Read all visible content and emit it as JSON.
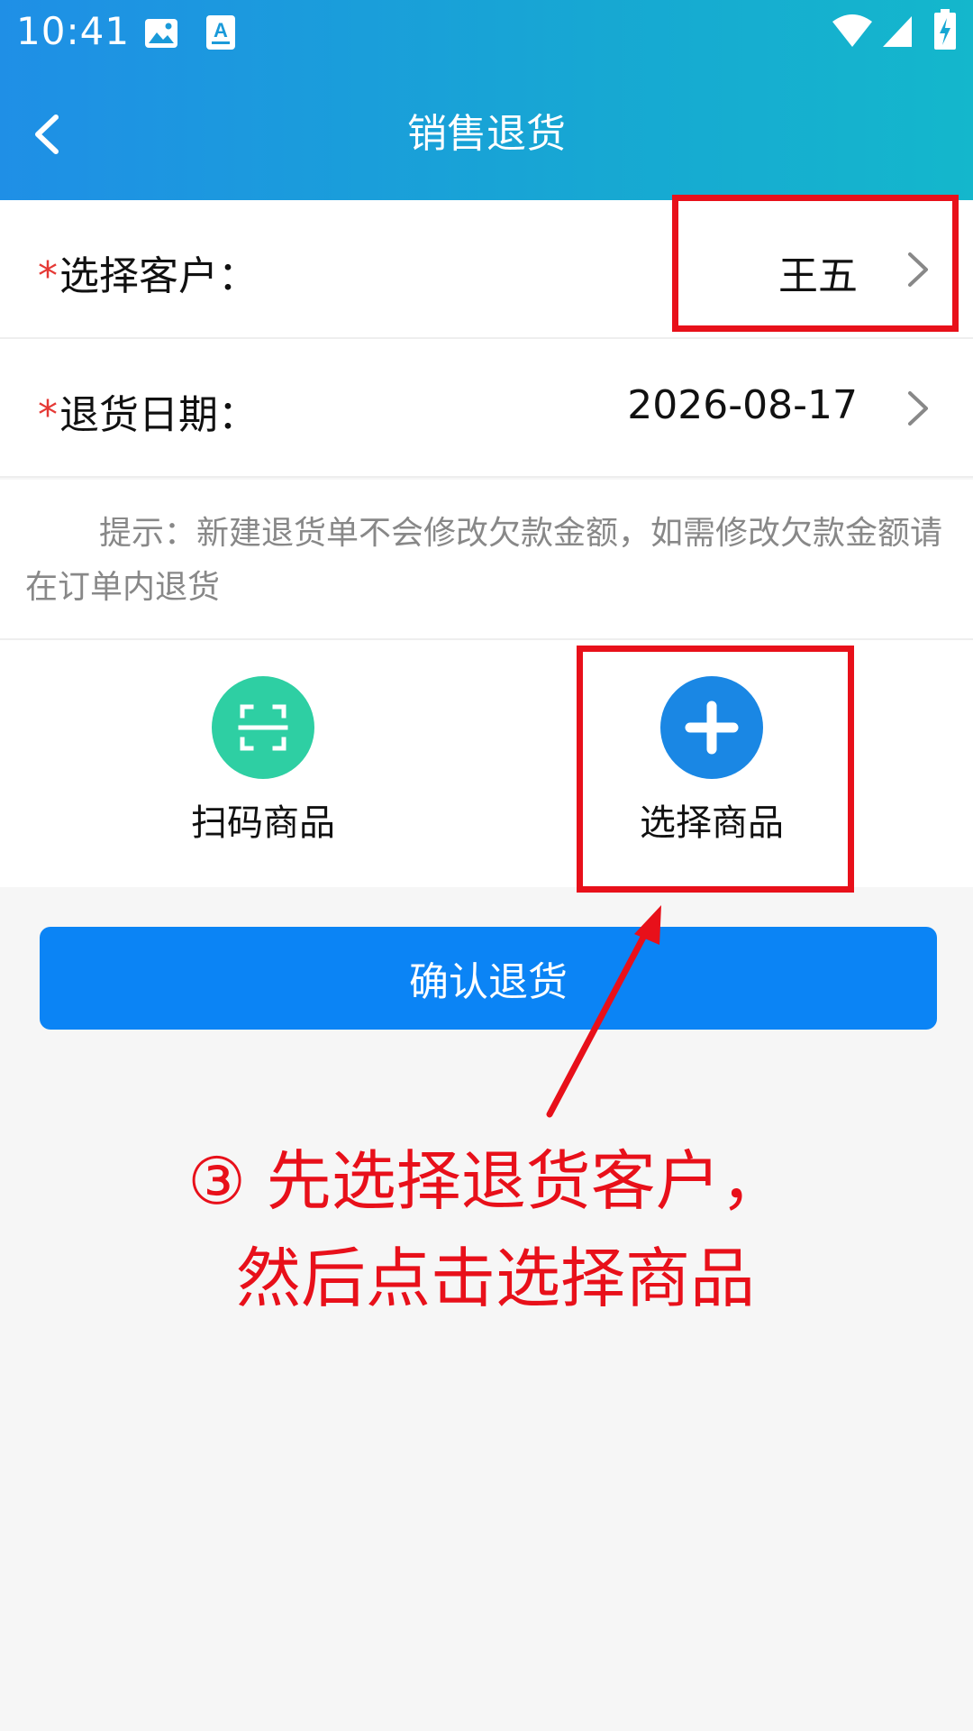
{
  "status_bar": {
    "time": "10:41"
  },
  "header": {
    "title": "销售退货"
  },
  "form": {
    "customer": {
      "required_mark": "*",
      "label": "选择客户：",
      "value": "王五"
    },
    "return_date": {
      "required_mark": "*",
      "label": "退货日期：",
      "value": "2026-08-17"
    }
  },
  "hint": {
    "text": "提示：新建退货单不会修改欠款金额，如需修改欠款金额请在订单内退货"
  },
  "actions": {
    "scan": {
      "label": "扫码商品",
      "icon": "scan-icon",
      "color": "#2ecfa3"
    },
    "select": {
      "label": "选择商品",
      "icon": "plus-icon",
      "color": "#1a87e4"
    }
  },
  "confirm_button": {
    "label": "确认退货",
    "color": "#0b84f5"
  },
  "annotation": {
    "line1": "③ 先选择退货客户，",
    "line2": "然后点击选择商品",
    "color": "#e8101a"
  }
}
